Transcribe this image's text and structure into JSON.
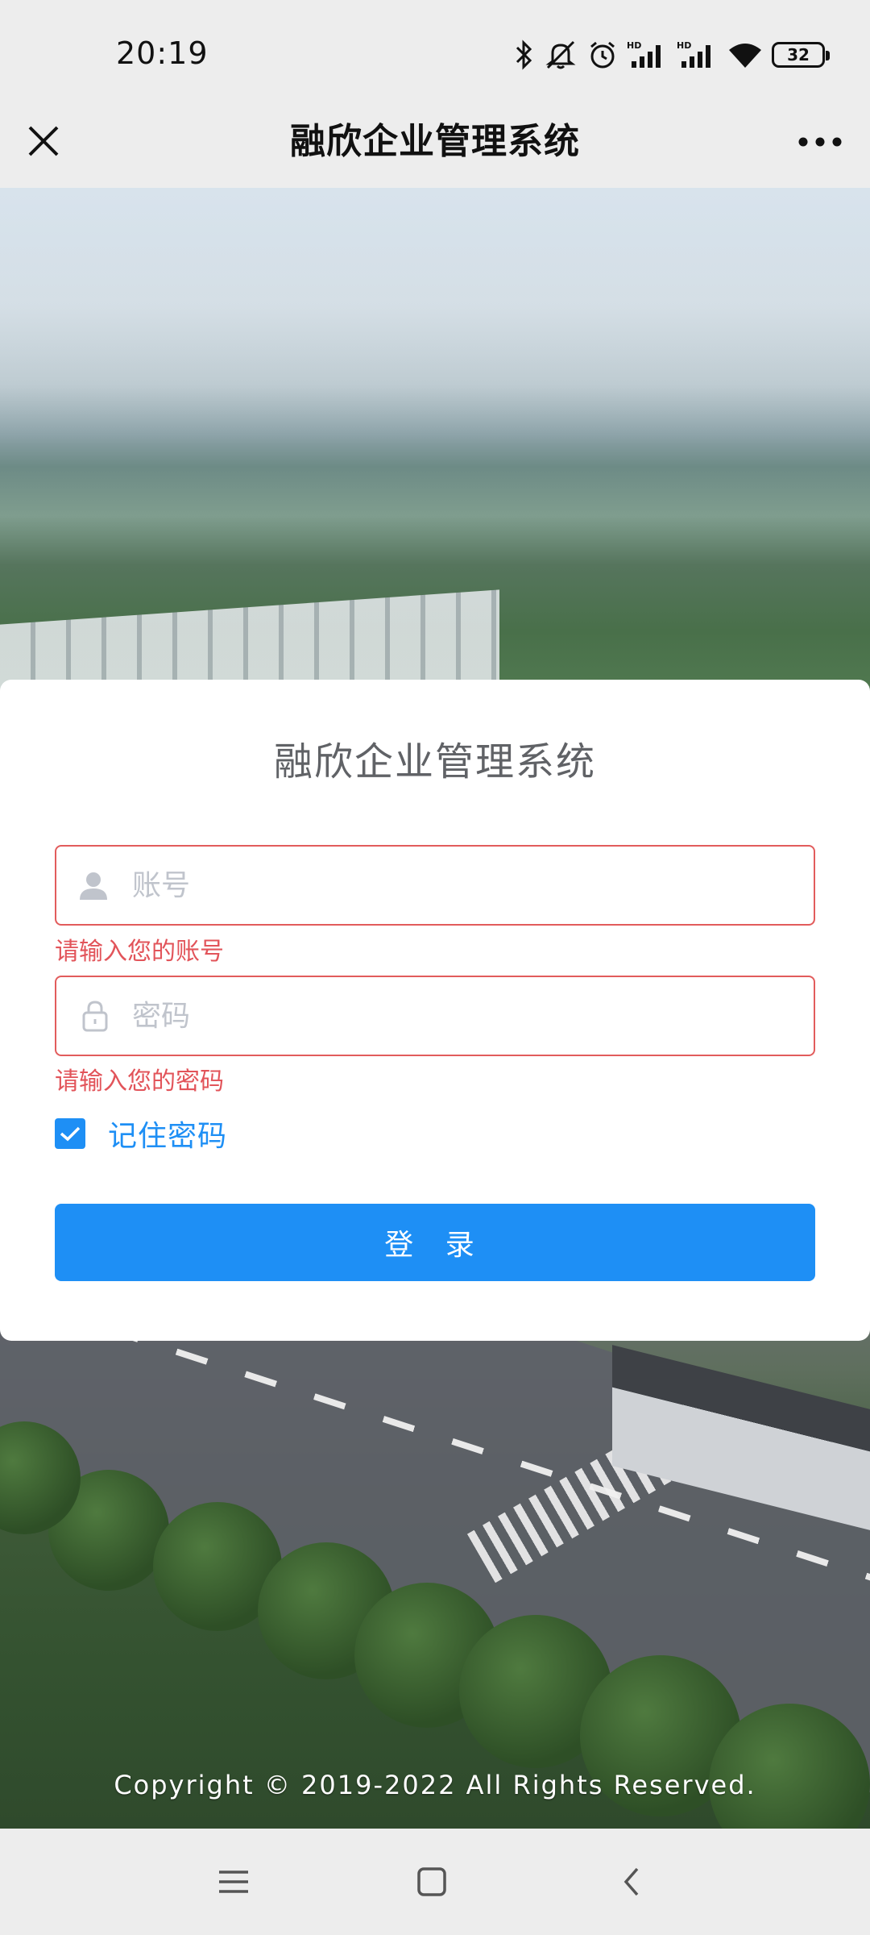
{
  "status_bar": {
    "time": "20:19",
    "battery": "32",
    "icons": [
      "bluetooth-icon",
      "mute-icon",
      "alarm-icon",
      "hd-signal-icon",
      "hd-signal-icon",
      "wifi-icon",
      "battery-icon"
    ]
  },
  "title_bar": {
    "title": "融欣企业管理系统",
    "close_icon": "close-icon",
    "more_icon": "more-icon"
  },
  "login": {
    "title": "融欣企业管理系统",
    "account_placeholder": "账号",
    "account_error": "请输入您的账号",
    "password_placeholder": "密码",
    "password_error": "请输入您的密码",
    "remember_label": "记住密码",
    "remember_checked": true,
    "login_label": "登 录"
  },
  "footer": {
    "copyright": "Copyright © 2019-2022 All Rights Reserved."
  },
  "bottom_nav": {
    "icons": [
      "menu-icon",
      "home-icon",
      "back-icon"
    ]
  },
  "colors": {
    "accent": "#1e8ff5",
    "error": "#e2545a",
    "background": "#ededed"
  }
}
